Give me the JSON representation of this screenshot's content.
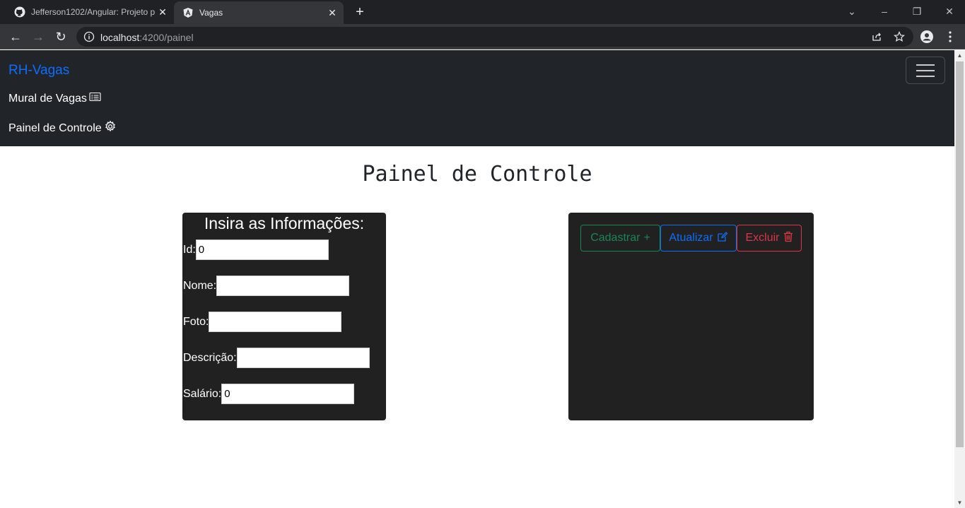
{
  "browser": {
    "tabs": [
      {
        "title": "Jefferson1202/Angular: Projeto p",
        "active": false
      },
      {
        "title": "Vagas",
        "active": true
      }
    ],
    "url_host": "localhost",
    "url_rest": ":4200/painel"
  },
  "navbar": {
    "brand": "RH-Vagas",
    "links": [
      {
        "label": "Mural de Vagas",
        "icon": "card-list-icon"
      },
      {
        "label": "Painel de Controle",
        "icon": "gear-icon"
      }
    ]
  },
  "main": {
    "title": "Painel de Controle",
    "form": {
      "heading": "Insira as Informações:",
      "fields": [
        {
          "label": "Id:",
          "value": "0"
        },
        {
          "label": "Nome:",
          "value": ""
        },
        {
          "label": "Foto:",
          "value": ""
        },
        {
          "label": "Descrição:",
          "value": ""
        },
        {
          "label": "Salário:",
          "value": "0"
        }
      ]
    },
    "buttons": {
      "cadastrar": "Cadastrar",
      "atualizar": "Atualizar",
      "excluir": "Excluir"
    }
  },
  "colors": {
    "brand": "#0d6efd",
    "success": "#198754",
    "primary": "#0d6efd",
    "danger": "#dc3545",
    "navbar_bg": "#212529",
    "card_bg": "#212121"
  }
}
